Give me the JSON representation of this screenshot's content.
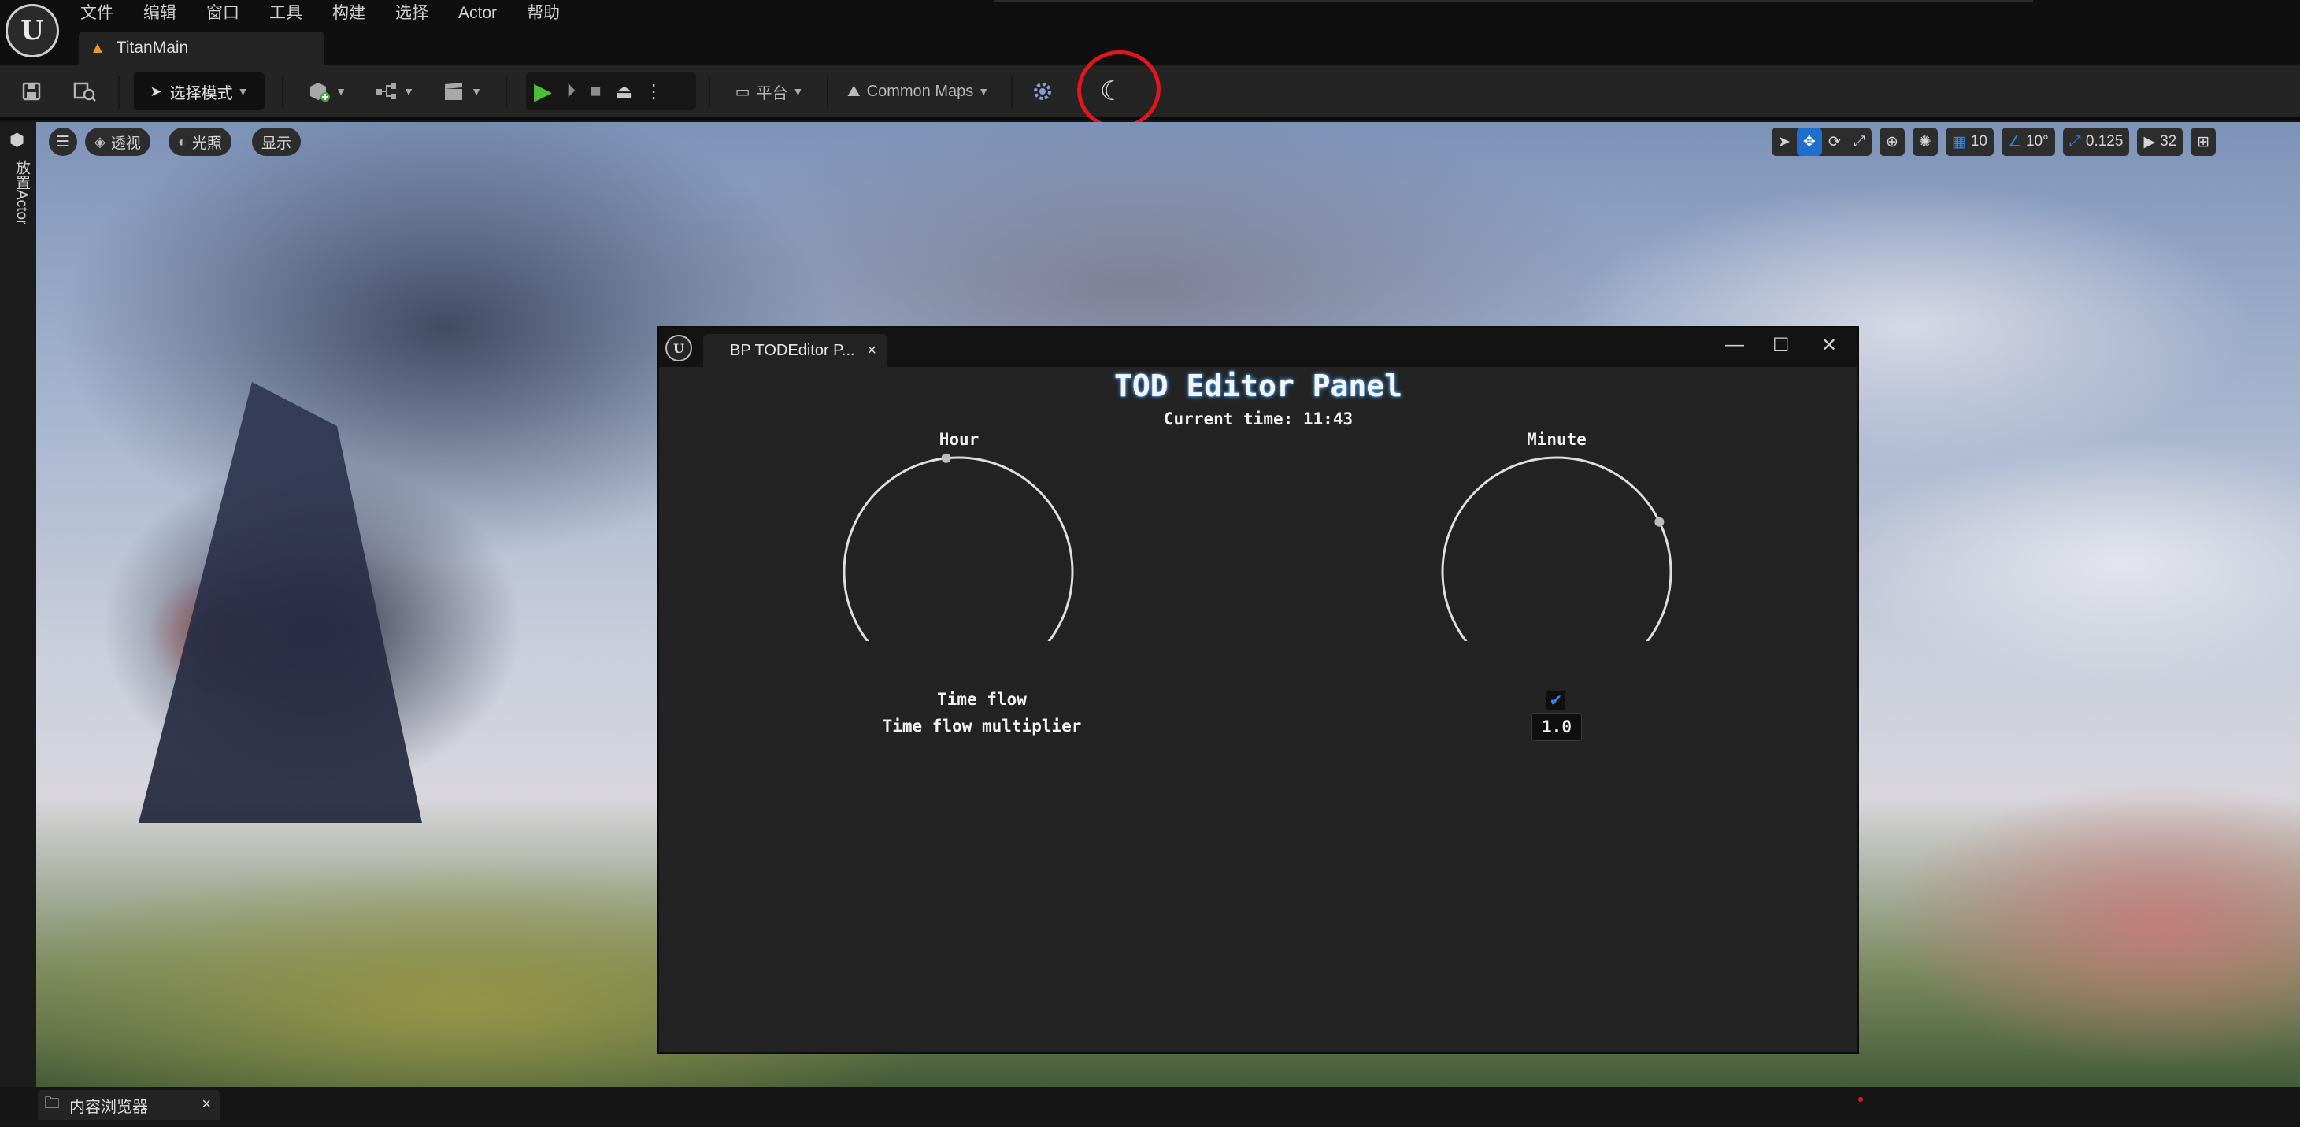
{
  "menu": {
    "items": [
      "文件",
      "编辑",
      "窗口",
      "工具",
      "构建",
      "选择",
      "Actor",
      "帮助"
    ],
    "document_tab": "TitanMain"
  },
  "toolbar": {
    "mode_label": "选择模式",
    "platform_label": "平台",
    "maps_label": "Common Maps"
  },
  "left_panel": {
    "place_actors_label": "放置Actor"
  },
  "viewport": {
    "perspective_label": "透视",
    "lit_label": "光照",
    "show_label": "显示",
    "grid_snap_value": "10",
    "rotation_snap_value": "10°",
    "scale_snap_value": "0.125",
    "camera_speed_value": "32"
  },
  "tod_window": {
    "tab_label": "BP TODEditor P...",
    "title": "TOD Editor Panel",
    "current_time_text": "Current time: 11:43",
    "hour_label": "Hour",
    "minute_label": "Minute",
    "hour_value": 11,
    "minute_value": 43,
    "time_flow_label": "Time flow",
    "time_flow_checked": true,
    "time_flow_multiplier_label": "Time flow multiplier",
    "time_flow_multiplier_value": "1.0"
  },
  "bottom": {
    "content_browser_label": "内容浏览器"
  },
  "colors": {
    "accent_blue": "#2c8cf0",
    "play_green": "#4cbe3a",
    "annotation_red": "#e3161e",
    "title_glow": "#4aa6ff"
  }
}
